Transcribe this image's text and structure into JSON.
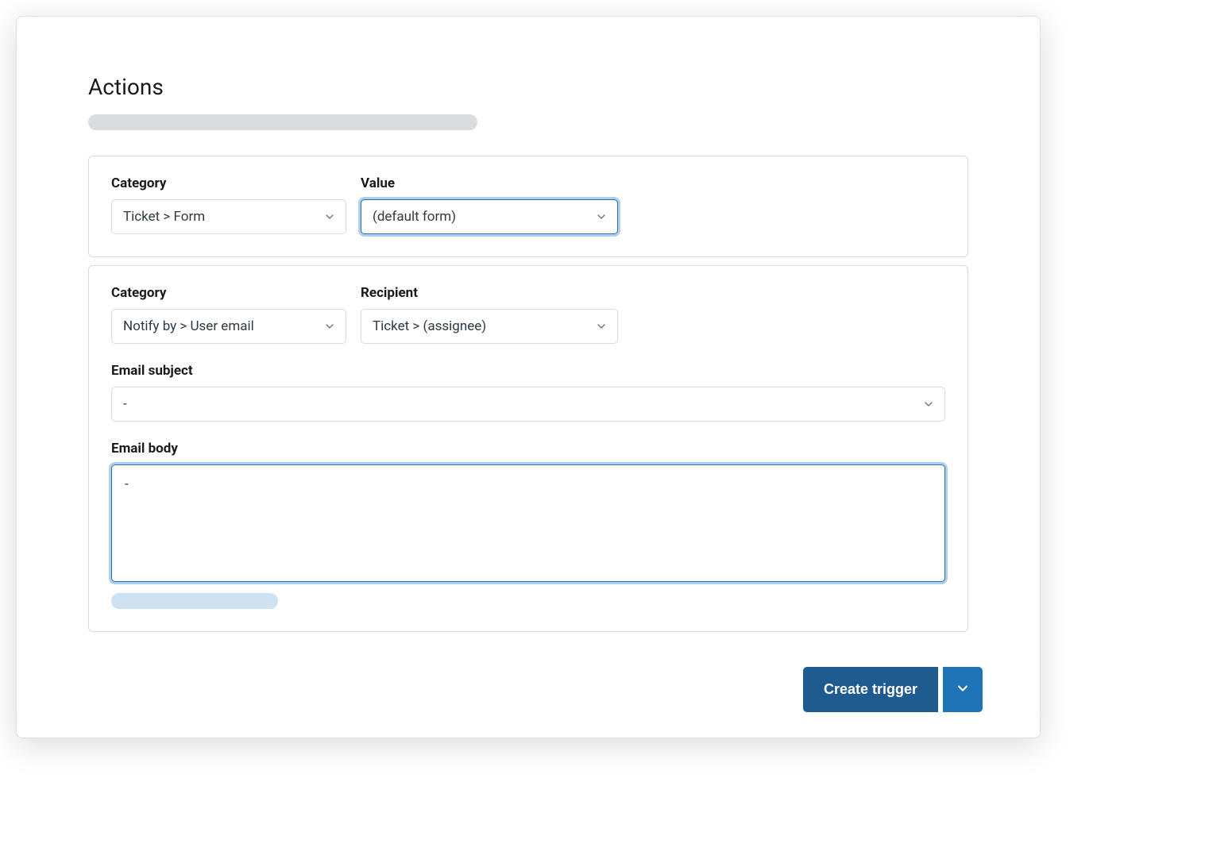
{
  "section": {
    "title": "Actions"
  },
  "actions": [
    {
      "category_label": "Category",
      "category_value": "Ticket > Form",
      "value_label": "Value",
      "value_value": "(default form)"
    },
    {
      "category_label": "Category",
      "category_value": "Notify by > User email",
      "recipient_label": "Recipient",
      "recipient_value": "Ticket > (assignee)",
      "subject_label": "Email subject",
      "subject_value": "-",
      "body_label": "Email body",
      "body_value": "-"
    }
  ],
  "footer": {
    "create_label": "Create trigger"
  }
}
